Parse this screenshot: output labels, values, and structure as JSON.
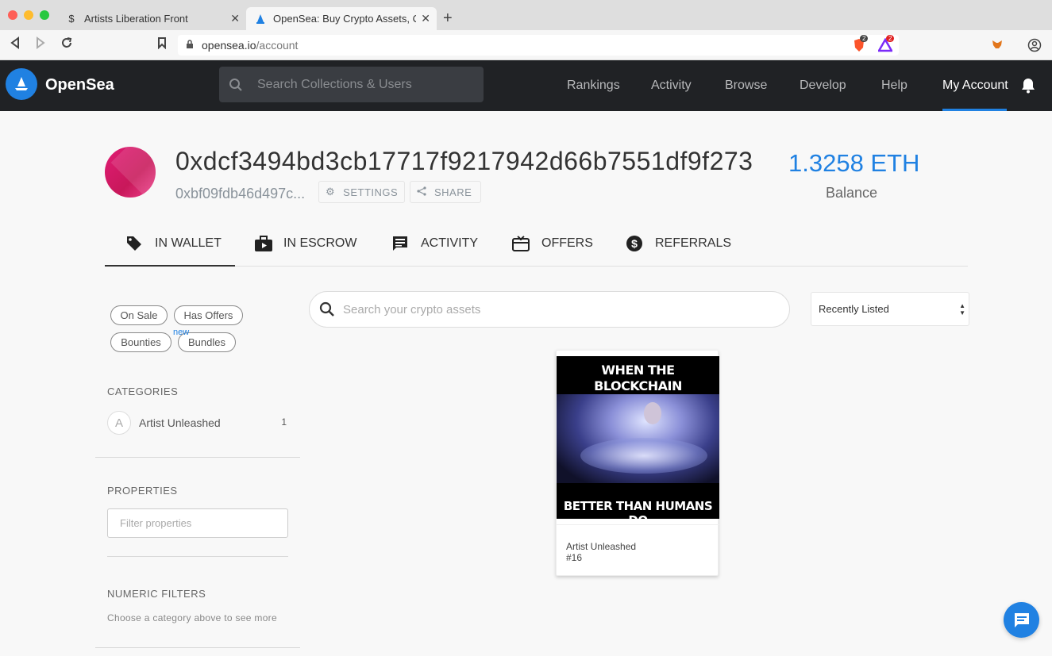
{
  "browser": {
    "tabs": [
      {
        "title": "Artists Liberation Front",
        "active": false
      },
      {
        "title": "OpenSea: Buy Crypto Assets, Cr",
        "active": true
      }
    ],
    "url_host": "opensea.io",
    "url_path": "/account",
    "brave_badge": "2",
    "rewards_badge": "2"
  },
  "header": {
    "brand": "OpenSea",
    "search_placeholder": "Search Collections & Users",
    "nav": [
      "Rankings",
      "Activity",
      "Browse",
      "Develop",
      "Help",
      "My Account"
    ],
    "active_nav": "My Account"
  },
  "profile": {
    "address": "0xdcf3494bd3cb17717f9217942d66b7551df9f273",
    "short_address": "0xbf09fdb46d497c...",
    "settings_label": "SETTINGS",
    "share_label": "SHARE",
    "balance": "1.3258 ETH",
    "balance_label": "Balance"
  },
  "tabs": [
    {
      "label": "IN WALLET",
      "icon": "tag-icon",
      "active": true
    },
    {
      "label": "IN ESCROW",
      "icon": "escrow-icon",
      "active": false
    },
    {
      "label": "ACTIVITY",
      "icon": "activity-icon",
      "active": false
    },
    {
      "label": "OFFERS",
      "icon": "gift-card-icon",
      "active": false
    },
    {
      "label": "REFERRALS",
      "icon": "dollar-icon",
      "active": false
    }
  ],
  "sidebar": {
    "filters": [
      "On Sale",
      "Has Offers",
      "Bounties",
      "Bundles"
    ],
    "new_badge": "new",
    "categories_title": "CATEGORIES",
    "categories": [
      {
        "initial": "A",
        "name": "Artist Unleashed",
        "count": "1"
      }
    ],
    "properties_title": "PROPERTIES",
    "properties_placeholder": "Filter properties",
    "numeric_title": "NUMERIC FILTERS",
    "numeric_hint": "Choose a category above to see more"
  },
  "main": {
    "search_placeholder": "Search your crypto assets",
    "sort_value": "Recently Listed",
    "assets": [
      {
        "meme_top": "WHEN THE BLOCKCHAIN UNDERSTANDS YOU",
        "meme_bottom": "BETTER THAN HUMANS DO",
        "name": "Artist Unleashed #16"
      }
    ]
  },
  "colors": {
    "accent": "#2081e2",
    "header_bg": "#202225",
    "avatar": "#e01b74"
  }
}
